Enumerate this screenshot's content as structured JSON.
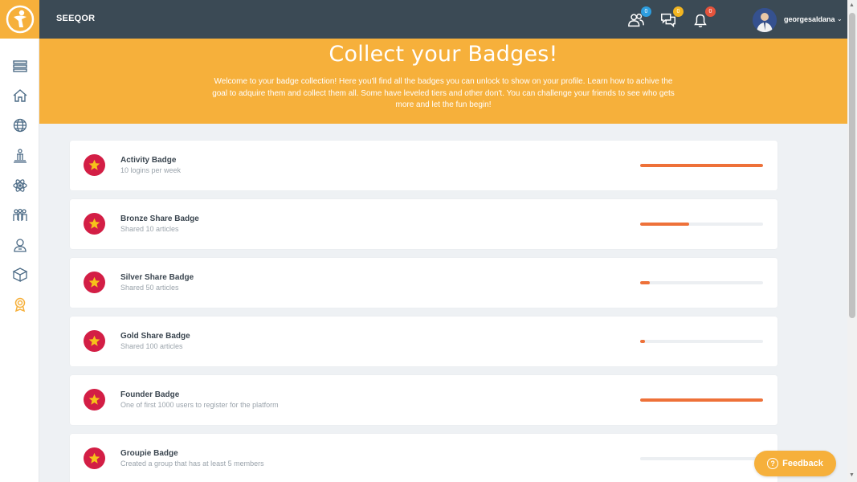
{
  "header": {
    "brand": "SEEQOR",
    "username": "georgesaldana",
    "caret": "⌄",
    "counts": {
      "friends": "0",
      "messages": "0",
      "notifications": "0"
    },
    "colors": {
      "friends": "#2d9ee0",
      "messages": "#f2b520",
      "notifications": "#e5533c"
    }
  },
  "sidebar": {
    "icons": [
      "menu-icon",
      "home-icon",
      "globe-icon",
      "institution-icon",
      "atom-icon",
      "group-icon",
      "user-profile-icon",
      "box-icon",
      "badge-award-icon"
    ]
  },
  "hero": {
    "title": "Collect your Badges!",
    "description": "Welcome to your badge collection! Here you'll find all the badges you can unlock to show on your profile. Learn how to achive the goal to adquire them and collect them all. Some have leveled tiers and other don't. You can challenge your friends to see who gets more and let the fun begin!"
  },
  "badges": [
    {
      "title": "Activity Badge",
      "subtitle": "10 logins per week",
      "progress": 1.0
    },
    {
      "title": "Bronze Share Badge",
      "subtitle": "Shared 10 articles",
      "progress": 0.4
    },
    {
      "title": "Silver Share Badge",
      "subtitle": "Shared 50 articles",
      "progress": 0.08
    },
    {
      "title": "Gold Share Badge",
      "subtitle": "Shared 100 articles",
      "progress": 0.04
    },
    {
      "title": "Founder Badge",
      "subtitle": "One of first 1000 users to register for the platform",
      "progress": 1.0
    },
    {
      "title": "Groupie Badge",
      "subtitle": "Created a group that has at least 5 members",
      "progress": 0.0
    }
  ],
  "feedback": {
    "label": "Feedback",
    "icon": "?"
  },
  "colors": {
    "accent": "#f6b03b",
    "topbar": "#3b4a55",
    "badge_red": "#d31e45",
    "progress": "#ee7139",
    "star": "#f6c21a"
  }
}
